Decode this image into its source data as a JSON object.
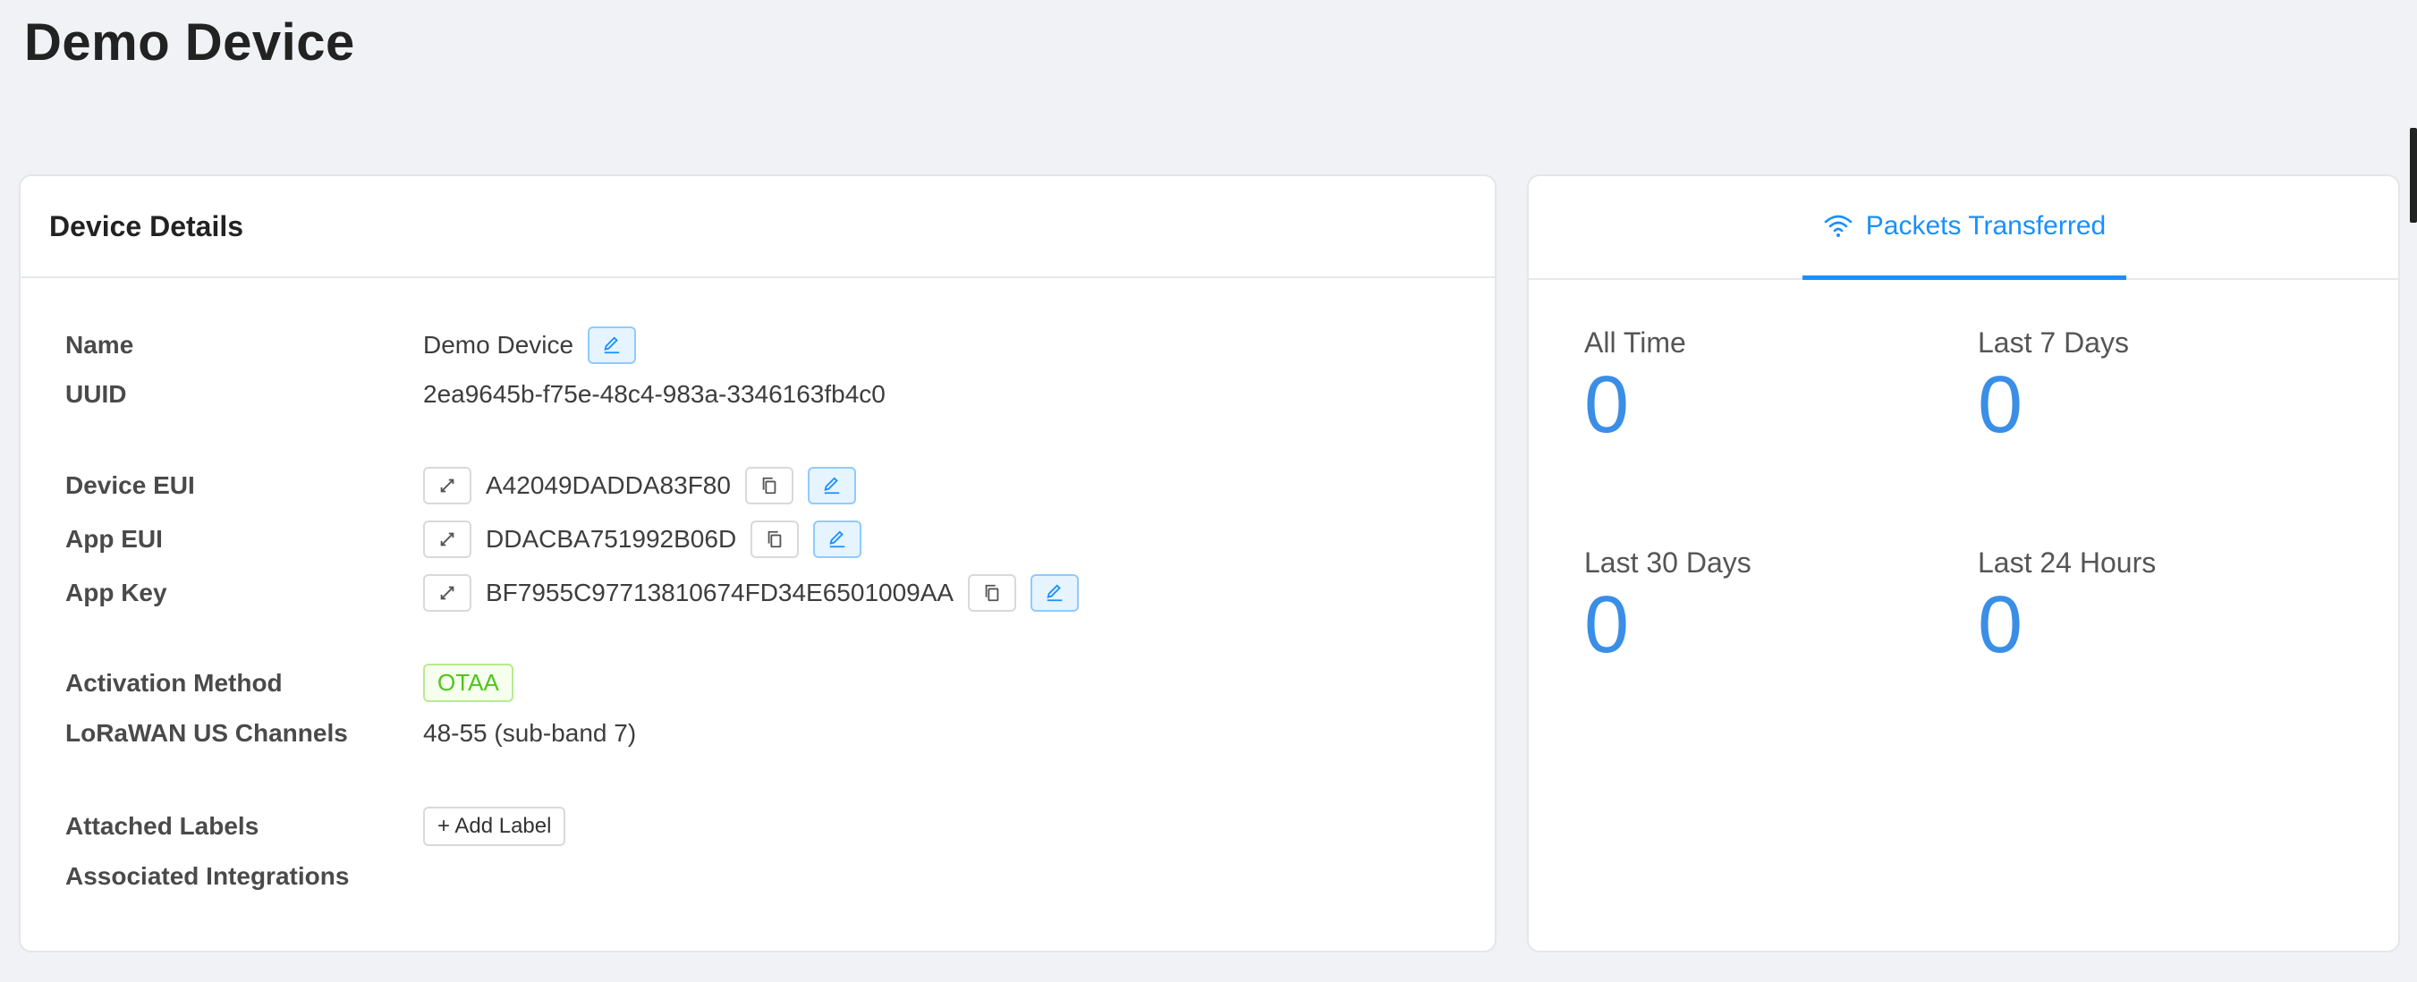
{
  "page": {
    "title": "Demo Device"
  },
  "details": {
    "header": "Device Details",
    "name_label": "Name",
    "name_value": "Demo Device",
    "uuid_label": "UUID",
    "uuid_value": "2ea9645b-f75e-48c4-983a-3346163fb4c0",
    "dev_eui_label": "Device EUI",
    "dev_eui_value": "A42049DADDA83F80",
    "app_eui_label": "App EUI",
    "app_eui_value": "DDACBA751992B06D",
    "app_key_label": "App Key",
    "app_key_value": "BF7955C97713810674FD34E6501009AA",
    "activation_label": "Activation Method",
    "activation_value": "OTAA",
    "channels_label": "LoRaWAN US Channels",
    "channels_value": "48-55 (sub-band 7)",
    "labels_label": "Attached Labels",
    "add_label_button": "+ Add Label",
    "integrations_label": "Associated Integrations"
  },
  "stats": {
    "tab_label": "Packets Transferred",
    "all_time_label": "All Time",
    "all_time_value": "0",
    "last_7_label": "Last 7 Days",
    "last_7_value": "0",
    "last_30_label": "Last 30 Days",
    "last_30_value": "0",
    "last_24_label": "Last 24 Hours",
    "last_24_value": "0"
  },
  "colors": {
    "accent": "#1890ff",
    "stat_value": "#3a8ee6",
    "success": "#52c41a",
    "background": "#f0f2f5"
  },
  "icons": [
    "edit-icon",
    "expand-icon",
    "copy-icon",
    "wifi-icon"
  ]
}
